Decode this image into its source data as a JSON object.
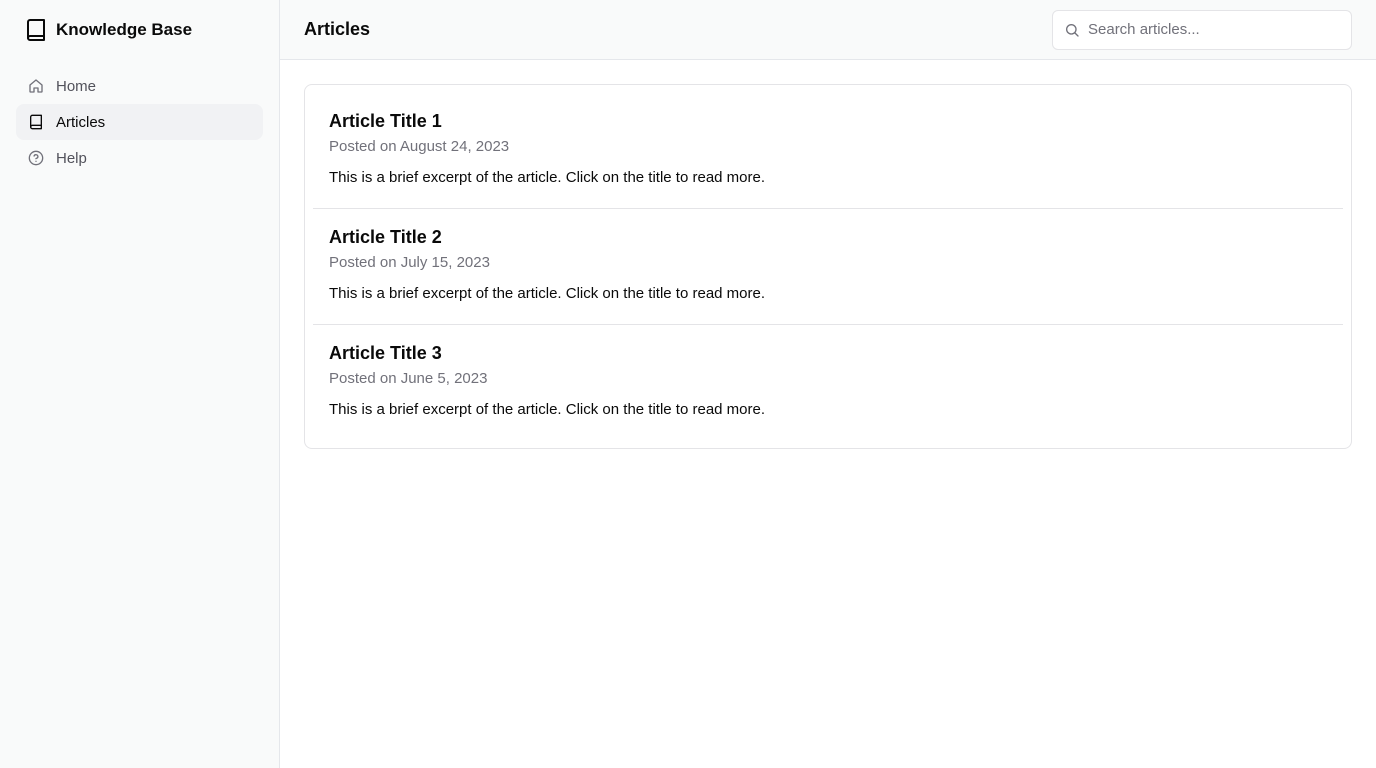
{
  "sidebar": {
    "brand_title": "Knowledge Base",
    "brand_icon": "book-icon",
    "items": [
      {
        "label": "Home",
        "icon": "home-icon",
        "active": false
      },
      {
        "label": "Articles",
        "icon": "book-icon",
        "active": true
      },
      {
        "label": "Help",
        "icon": "help-circle-icon",
        "active": false
      }
    ]
  },
  "header": {
    "title": "Articles",
    "search": {
      "placeholder": "Search articles...",
      "value": ""
    }
  },
  "articles": [
    {
      "title": "Article Title 1",
      "date": "Posted on August 24, 2023",
      "excerpt": "This is a brief excerpt of the article. Click on the title to read more."
    },
    {
      "title": "Article Title 2",
      "date": "Posted on July 15, 2023",
      "excerpt": "This is a brief excerpt of the article. Click on the title to read more."
    },
    {
      "title": "Article Title 3",
      "date": "Posted on June 5, 2023",
      "excerpt": "This is a brief excerpt of the article. Click on the title to read more."
    }
  ],
  "colors": {
    "sidebar_bg": "#f9fafa",
    "active_item_bg": "#f1f2f4",
    "border": "#e4e4e7",
    "muted_text": "#71717a"
  }
}
